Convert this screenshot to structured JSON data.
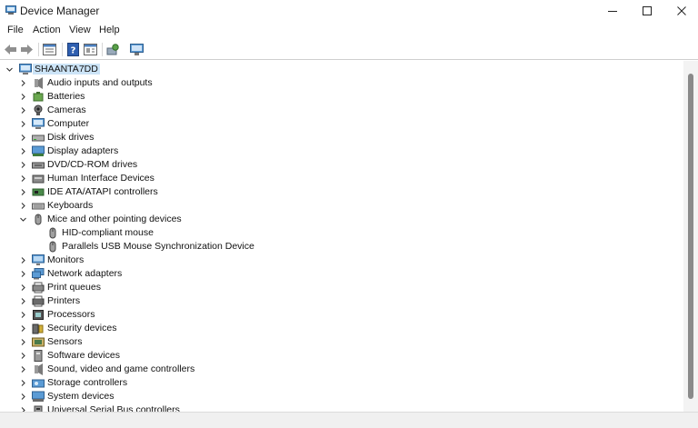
{
  "window": {
    "title": "Device Manager",
    "minimize_glyph": "—",
    "maximize_glyph": "☐",
    "close_glyph": "✕"
  },
  "menu": {
    "file": "File",
    "action": "Action",
    "view": "View",
    "help": "Help"
  },
  "toolbar": {
    "buttons": [
      "back-icon",
      "forward-icon",
      "properties-icon",
      "help-icon",
      "view-icon",
      "scan-hardware-icon",
      "monitor-icon"
    ]
  },
  "tree": {
    "root": "SHAANTA7DD",
    "items": [
      {
        "label": "Audio inputs and outputs",
        "icon": "audio-icon"
      },
      {
        "label": "Batteries",
        "icon": "battery-icon"
      },
      {
        "label": "Cameras",
        "icon": "camera-icon"
      },
      {
        "label": "Computer",
        "icon": "computer-icon"
      },
      {
        "label": "Disk drives",
        "icon": "disk-drive-icon"
      },
      {
        "label": "Display adapters",
        "icon": "display-adapter-icon"
      },
      {
        "label": "DVD/CD-ROM drives",
        "icon": "dvd-drive-icon"
      },
      {
        "label": "Human Interface Devices",
        "icon": "hid-icon"
      },
      {
        "label": "IDE ATA/ATAPI controllers",
        "icon": "ide-controller-icon"
      },
      {
        "label": "Keyboards",
        "icon": "keyboard-icon"
      },
      {
        "label": "Mice and other pointing devices",
        "icon": "mouse-icon",
        "expanded": true,
        "children": [
          "HID-compliant mouse",
          "Parallels USB Mouse Synchronization Device"
        ]
      },
      {
        "label": "Monitors",
        "icon": "monitor-icon"
      },
      {
        "label": "Network adapters",
        "icon": "network-adapter-icon"
      },
      {
        "label": "Print queues",
        "icon": "print-queue-icon"
      },
      {
        "label": "Printers",
        "icon": "printer-icon"
      },
      {
        "label": "Processors",
        "icon": "processor-icon"
      },
      {
        "label": "Security devices",
        "icon": "security-device-icon"
      },
      {
        "label": "Sensors",
        "icon": "sensor-icon"
      },
      {
        "label": "Software devices",
        "icon": "software-device-icon"
      },
      {
        "label": "Sound, video and game controllers",
        "icon": "sound-controller-icon"
      },
      {
        "label": "Storage controllers",
        "icon": "storage-controller-icon"
      },
      {
        "label": "System devices",
        "icon": "system-device-icon"
      },
      {
        "label": "Universal Serial Bus controllers",
        "icon": "usb-controller-icon"
      }
    ]
  },
  "colors": {
    "selection": "#cce4f7",
    "scroll_thumb": "#8a8a8a"
  }
}
